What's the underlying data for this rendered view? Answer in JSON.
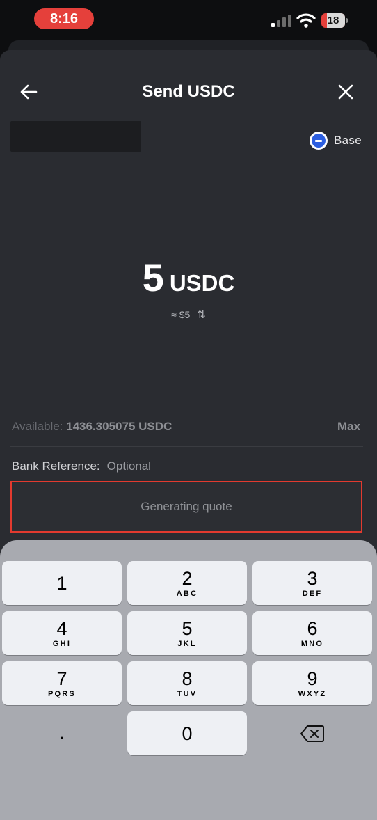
{
  "status_bar": {
    "time": "8:16",
    "battery": "18"
  },
  "header": {
    "title": "Send USDC"
  },
  "network": {
    "name": "Base",
    "icon": "base-network-icon",
    "color": "#2d5fe0"
  },
  "amount": {
    "value": "5",
    "currency": "USDC",
    "fiat": "≈ $5",
    "swap_icon": "⇅"
  },
  "balance": {
    "label": "Available:",
    "value": "1436.305075 USDC",
    "max_label": "Max"
  },
  "bank_reference": {
    "label": "Bank Reference:",
    "placeholder": "Optional"
  },
  "action": {
    "label": "Generating quote"
  },
  "keypad": {
    "keys": [
      {
        "digit": "1",
        "letters": ""
      },
      {
        "digit": "2",
        "letters": "ABC"
      },
      {
        "digit": "3",
        "letters": "DEF"
      },
      {
        "digit": "4",
        "letters": "GHI"
      },
      {
        "digit": "5",
        "letters": "JKL"
      },
      {
        "digit": "6",
        "letters": "MNO"
      },
      {
        "digit": "7",
        "letters": "PQRS"
      },
      {
        "digit": "8",
        "letters": "TUV"
      },
      {
        "digit": "9",
        "letters": "WXYZ"
      },
      {
        "digit": ".",
        "letters": ""
      },
      {
        "digit": "0",
        "letters": ""
      }
    ]
  },
  "colors": {
    "sheet": "#2a2c31",
    "highlight": "#e23a2f",
    "time_pill": "#e5403b"
  }
}
